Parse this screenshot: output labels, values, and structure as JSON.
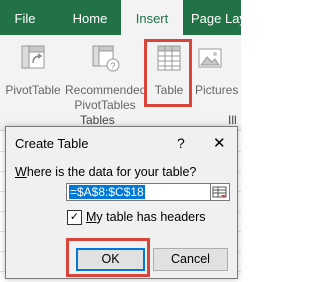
{
  "tabs": [
    {
      "label": "File",
      "active": false
    },
    {
      "label": "Home",
      "active": false
    },
    {
      "label": "Insert",
      "active": true
    },
    {
      "label": "Page Lay",
      "active": false
    }
  ],
  "ribbon": {
    "pivottable_label": "PivotTable",
    "recommended_line1": "Recommended",
    "recommended_line2": "PivotTables",
    "table_label": "Table",
    "pictures_label": "Pictures",
    "group_tables_label": "Tables",
    "group_ill_label": "Ill"
  },
  "dialog": {
    "title": "Create Table",
    "help_glyph": "?",
    "close_glyph": "✕",
    "prompt": "Where is the data for your table?",
    "range_value": "=$A$8:$C$18",
    "headers_checked": true,
    "headers_label": "My table has headers",
    "ok_label": "OK",
    "cancel_label": "Cancel"
  },
  "colors": {
    "excel_green": "#217346",
    "highlight_red": "#d9453b",
    "accent_blue": "#0078d7"
  }
}
